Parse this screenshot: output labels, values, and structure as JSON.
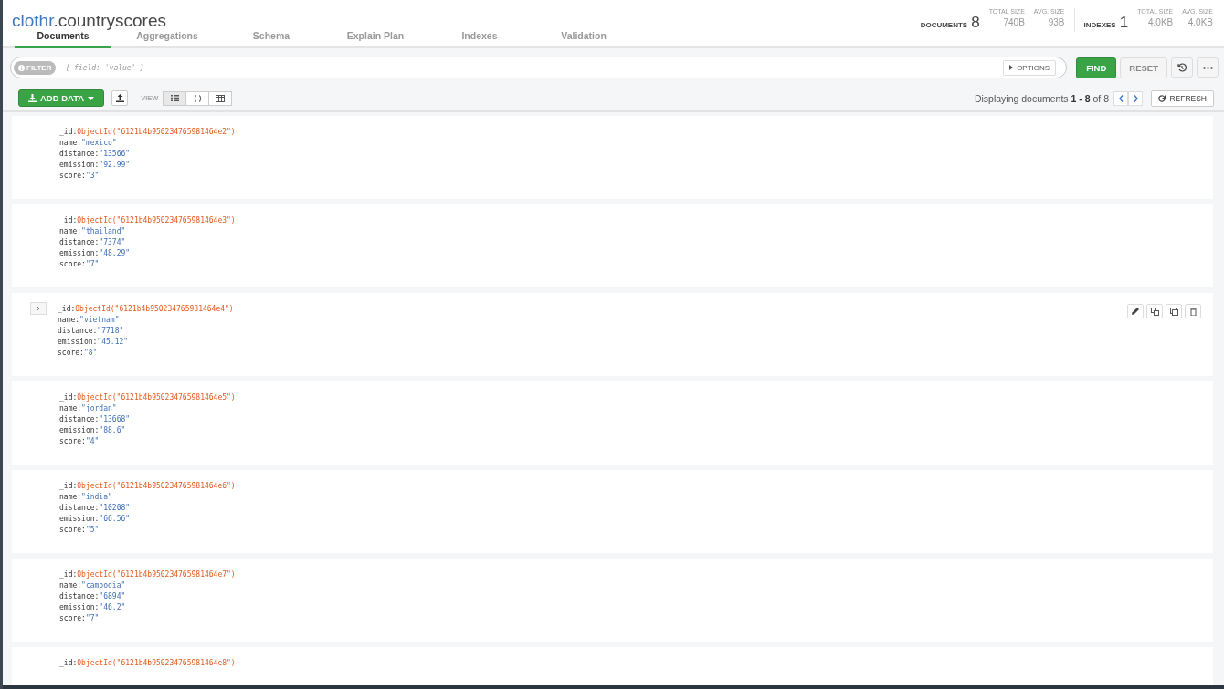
{
  "field_separator": ":",
  "title": {
    "database": "clothr",
    "collection": ".countryscores"
  },
  "stats": {
    "documents_label": "DOCUMENTS",
    "documents_count": "8",
    "doc_total_size_label": "TOTAL SIZE",
    "doc_total_size": "740B",
    "doc_avg_size_label": "AVG. SIZE",
    "doc_avg_size": "93B",
    "indexes_label": "INDEXES",
    "indexes_count": "1",
    "idx_total_size_label": "TOTAL SIZE",
    "idx_total_size": "4.0KB",
    "idx_avg_size_label": "AVG. SIZE",
    "idx_avg_size": "4.0KB"
  },
  "tabs": [
    {
      "label": "Documents",
      "selected": true
    },
    {
      "label": "Aggregations",
      "selected": false
    },
    {
      "label": "Schema",
      "selected": false
    },
    {
      "label": "Explain Plan",
      "selected": false
    },
    {
      "label": "Indexes",
      "selected": false
    },
    {
      "label": "Validation",
      "selected": false
    }
  ],
  "filter": {
    "label": "FILTER",
    "placeholder": "{ field: 'value' }",
    "options": "OPTIONS",
    "find": "FIND",
    "reset": "RESET"
  },
  "toolbar": {
    "add_data": "ADD DATA",
    "view_label": "VIEW",
    "views": [
      {
        "kind": "list",
        "selected": true
      },
      {
        "kind": "json",
        "selected": false
      },
      {
        "kind": "table",
        "selected": false
      }
    ],
    "displaying": "Displaying documents",
    "range": "1 - 8",
    "of": "of 8",
    "refresh": "REFRESH"
  },
  "documents": [
    {
      "hovered": false,
      "fields": [
        {
          "key": "_id",
          "value": "ObjectId(\"6121b4b950234765981464e2\")",
          "kind": "objectid"
        },
        {
          "key": "name",
          "value": "\"mexico\"",
          "kind": "string"
        },
        {
          "key": "distance",
          "value": "\"13566\"",
          "kind": "string"
        },
        {
          "key": "emission",
          "value": "\"92.99\"",
          "kind": "string"
        },
        {
          "key": "score",
          "value": "\"3\"",
          "kind": "string"
        }
      ]
    },
    {
      "hovered": false,
      "fields": [
        {
          "key": "_id",
          "value": "ObjectId(\"6121b4b950234765981464e3\")",
          "kind": "objectid"
        },
        {
          "key": "name",
          "value": "\"thailand\"",
          "kind": "string"
        },
        {
          "key": "distance",
          "value": "\"7374\"",
          "kind": "string"
        },
        {
          "key": "emission",
          "value": "\"48.29\"",
          "kind": "string"
        },
        {
          "key": "score",
          "value": "\"7\"",
          "kind": "string"
        }
      ]
    },
    {
      "hovered": true,
      "fields": [
        {
          "key": "_id",
          "value": "ObjectId(\"6121b4b950234765981464e4\")",
          "kind": "objectid"
        },
        {
          "key": "name",
          "value": "\"vietnam\"",
          "kind": "string"
        },
        {
          "key": "distance",
          "value": "\"7718\"",
          "kind": "string"
        },
        {
          "key": "emission",
          "value": "\"45.12\"",
          "kind": "string"
        },
        {
          "key": "score",
          "value": "\"8\"",
          "kind": "string"
        }
      ]
    },
    {
      "hovered": false,
      "fields": [
        {
          "key": "_id",
          "value": "ObjectId(\"6121b4b950234765981464e5\")",
          "kind": "objectid"
        },
        {
          "key": "name",
          "value": "\"jordan\"",
          "kind": "string"
        },
        {
          "key": "distance",
          "value": "\"13668\"",
          "kind": "string"
        },
        {
          "key": "emission",
          "value": "\"88.6\"",
          "kind": "string"
        },
        {
          "key": "score",
          "value": "\"4\"",
          "kind": "string"
        }
      ]
    },
    {
      "hovered": false,
      "fields": [
        {
          "key": "_id",
          "value": "ObjectId(\"6121b4b950234765981464e6\")",
          "kind": "objectid"
        },
        {
          "key": "name",
          "value": "\"india\"",
          "kind": "string"
        },
        {
          "key": "distance",
          "value": "\"10208\"",
          "kind": "string"
        },
        {
          "key": "emission",
          "value": "\"66.56\"",
          "kind": "string"
        },
        {
          "key": "score",
          "value": "\"5\"",
          "kind": "string"
        }
      ]
    },
    {
      "hovered": false,
      "fields": [
        {
          "key": "_id",
          "value": "ObjectId(\"6121b4b950234765981464e7\")",
          "kind": "objectid"
        },
        {
          "key": "name",
          "value": "\"cambodia\"",
          "kind": "string"
        },
        {
          "key": "distance",
          "value": "\"6894\"",
          "kind": "string"
        },
        {
          "key": "emission",
          "value": "\"46.2\"",
          "kind": "string"
        },
        {
          "key": "score",
          "value": "\"7\"",
          "kind": "string"
        }
      ]
    },
    {
      "hovered": false,
      "fields": [
        {
          "key": "_id",
          "value": "ObjectId(\"6121b4b950234765981464e8\")",
          "kind": "objectid"
        }
      ]
    }
  ]
}
